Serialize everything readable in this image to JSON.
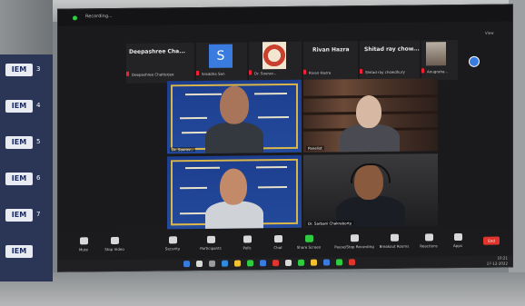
{
  "screen": {
    "recording_label": "Recording...",
    "view_label": "View"
  },
  "participants_strip": [
    {
      "name": "Deepashree Cha...",
      "sub": "Deepashree Chatterjee"
    },
    {
      "name": "",
      "sub": "Sraddha Sen"
    },
    {
      "name": "",
      "sub": "Dr. Sourav..."
    },
    {
      "name": "Rivan Hazra",
      "sub": "Rivan Hazra"
    },
    {
      "name": "Shitad  ray chow...",
      "sub": "Shitad ray chowdhury"
    },
    {
      "name": "",
      "sub": "Anugraha..."
    }
  ],
  "avatar_letter": "S",
  "video_tiles": [
    {
      "tag": "Dr. Sourav..."
    },
    {
      "tag": "Panelist"
    },
    {
      "tag": ""
    },
    {
      "tag": "Dr. Sarbani Chakraborty"
    }
  ],
  "toolbar": {
    "items": [
      "Mute",
      "Stop Video",
      "Security",
      "Participants",
      "Polls",
      "Chat",
      "Share Screen",
      "Pause/Stop Recording",
      "Breakout Rooms",
      "Reactions",
      "Apps"
    ],
    "end_label": "End"
  },
  "taskbar": {
    "time": "10:21",
    "date": "17-12-2022"
  },
  "banner": {
    "logo_text": "IEM",
    "numbers": [
      "3",
      "4",
      "5",
      "6",
      "7"
    ]
  },
  "colors": {
    "accent_blue": "#3a7be0",
    "rec_green": "#2ecc40",
    "end_red": "#e0342c",
    "poster_blue": "#1d3e8f",
    "poster_gold": "#d9b64a"
  }
}
